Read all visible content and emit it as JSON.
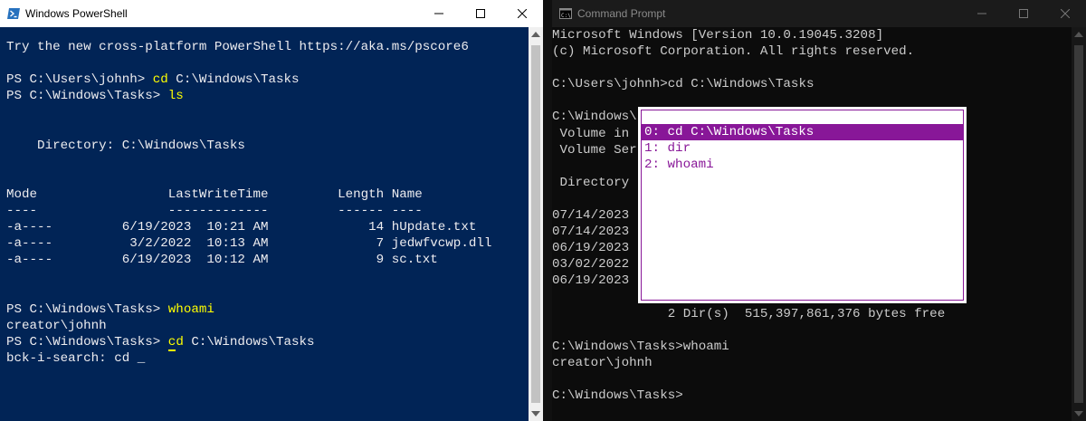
{
  "powershell": {
    "title": "Windows PowerShell",
    "lines": [
      {
        "t": "Try the new cross-platform PowerShell https://aka.ms/pscore6"
      },
      {
        "t": ""
      },
      {
        "p": "PS C:\\Users\\johnh> ",
        "c": "cd",
        "r": " C:\\Windows\\Tasks"
      },
      {
        "p": "PS C:\\Windows\\Tasks> ",
        "c": "ls",
        "r": ""
      },
      {
        "t": ""
      },
      {
        "t": ""
      },
      {
        "t": "    Directory: C:\\Windows\\Tasks"
      },
      {
        "t": ""
      },
      {
        "t": ""
      },
      {
        "t": "Mode                 LastWriteTime         Length Name"
      },
      {
        "t": "----                 -------------         ------ ----"
      },
      {
        "t": "-a----         6/19/2023  10:21 AM             14 hUpdate.txt"
      },
      {
        "t": "-a----          3/2/2022  10:13 AM              7 jedwfvcwp.dll"
      },
      {
        "t": "-a----         6/19/2023  10:12 AM              9 sc.txt"
      },
      {
        "t": ""
      },
      {
        "t": ""
      },
      {
        "p": "PS C:\\Windows\\Tasks> ",
        "c": "whoami",
        "r": ""
      },
      {
        "t": "creator\\johnh"
      }
    ],
    "search_prompt": "PS C:\\Windows\\Tasks> ",
    "search_cmd_first": "c",
    "search_cmd_rest": "d",
    "search_rest": " C:\\Windows\\Tasks",
    "bck_search": "bck-i-search: cd _"
  },
  "cmd": {
    "title": "Command Prompt",
    "lines": [
      "Microsoft Windows [Version 10.0.19045.3208]",
      "(c) Microsoft Corporation. All rights reserved.",
      "",
      "C:\\Users\\johnh>cd C:\\Windows\\Tasks",
      "",
      "C:\\Windows\\",
      " Volume in ",
      " Volume Ser",
      "",
      " Directory ",
      "",
      "07/14/2023 ",
      "07/14/2023 ",
      "06/19/2023 ",
      "03/02/2022 ",
      "06/19/2023 ",
      "",
      "               2 Dir(s)  515,397,861,376 bytes free",
      "",
      "C:\\Windows\\Tasks>whoami",
      "creator\\johnh",
      "",
      "C:\\Windows\\Tasks>"
    ],
    "history": [
      "0: cd C:\\Windows\\Tasks",
      "1: dir",
      "2: whoami"
    ],
    "selected_history": 0
  },
  "colors": {
    "ps_bg": "#012456",
    "cmd_bg": "#0c0c0c",
    "history_accent": "#881798",
    "ps_command": "#ffff00"
  }
}
